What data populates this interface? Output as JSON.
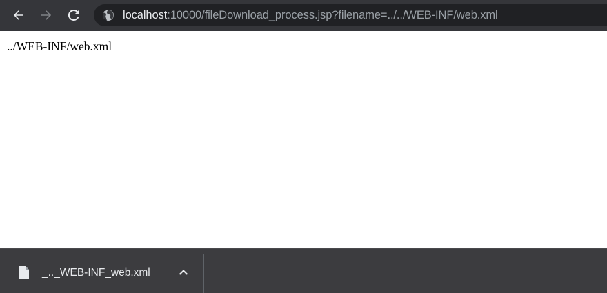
{
  "toolbar": {
    "back_icon": "arrow-back-icon",
    "forward_icon": "arrow-forward-icon",
    "reload_icon": "reload-icon",
    "site_info_icon": "globe-icon",
    "url_host": "localhost",
    "url_rest": ":10000/fileDownload_process.jsp?filename=../../WEB-INF/web.xml"
  },
  "page": {
    "text": "../WEB-INF/web.xml"
  },
  "download_shelf": {
    "items": [
      {
        "file_name": "_.._WEB-INF_web.xml",
        "icon": "file-icon",
        "menu_icon": "chevron-up-icon"
      }
    ]
  },
  "colors": {
    "toolbar_bg": "#35363a",
    "omnibox_bg": "#202124",
    "shelf_bg": "#3c3c3f",
    "url_host": "#e8eaed",
    "url_rest": "#9aa0a6"
  }
}
